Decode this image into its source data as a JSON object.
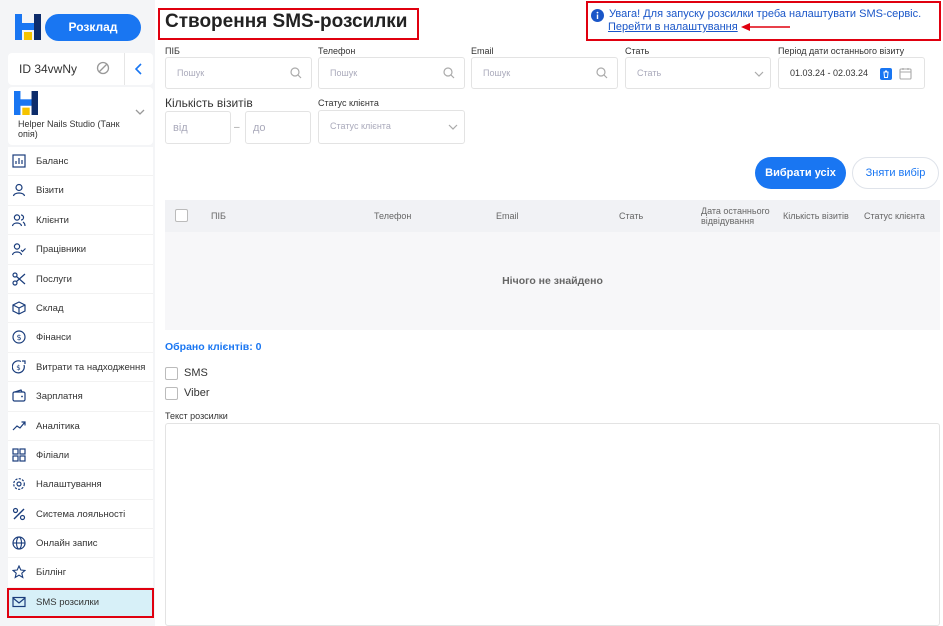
{
  "sidebar": {
    "schedule_label": "Розклад",
    "id_label": "ID 34vwNy",
    "studio_name": "Helper Nails Studio (Танк опія)",
    "items": [
      {
        "label": "Баланс",
        "icon": "bar-chart-icon"
      },
      {
        "label": "Візити",
        "icon": "user-icon"
      },
      {
        "label": "Клієнти",
        "icon": "users-icon"
      },
      {
        "label": "Працівники",
        "icon": "user-check-icon"
      },
      {
        "label": "Послуги",
        "icon": "scissors-icon"
      },
      {
        "label": "Склад",
        "icon": "box-icon"
      },
      {
        "label": "Фінанси",
        "icon": "dollar-icon"
      },
      {
        "label": "Витрати та надходження",
        "icon": "dollar-arrow-icon"
      },
      {
        "label": "Зарплатня",
        "icon": "wallet-icon"
      },
      {
        "label": "Аналітика",
        "icon": "trend-icon"
      },
      {
        "label": "Філіали",
        "icon": "grid-icon"
      },
      {
        "label": "Налаштування",
        "icon": "gear-icon"
      },
      {
        "label": "Система лояльності",
        "icon": "percent-icon"
      },
      {
        "label": "Онлайн запис",
        "icon": "globe-icon"
      },
      {
        "label": "Біллінг",
        "icon": "star-icon"
      },
      {
        "label": "SMS розсилки",
        "icon": "mail-icon",
        "active": true
      }
    ]
  },
  "header": {
    "title": "Створення SMS-розсилки",
    "warning_text": "Увага! Для запуску розсилки треба налаштувати SMS-сервіс.",
    "warning_link": "Перейти в налаштування"
  },
  "filters": {
    "name_label": "ПІБ",
    "name_placeholder": "Пошук",
    "phone_label": "Телефон",
    "phone_placeholder": "Пошук",
    "email_label": "Email",
    "email_placeholder": "Пошук",
    "gender_label": "Стать",
    "gender_placeholder": "Стать",
    "period_label": "Період дати останнього візиту",
    "period_value": "01.03.24 - 02.03.24",
    "visits_label": "Кількість візитів",
    "visits_from": "від",
    "visits_to": "до",
    "status_label": "Статус клієнта",
    "status_placeholder": "Статус клієнта"
  },
  "actions": {
    "select_all": "Вибрати усіх",
    "clear_selection": "Зняти вибір"
  },
  "table": {
    "columns": [
      "ПІБ",
      "Телефон",
      "Email",
      "Стать",
      "Дата останнього відвідування",
      "Кількість візитів",
      "Статус клієнта"
    ],
    "empty_text": "Нічого не знайдено"
  },
  "selected_text": "Обрано клієнтів: 0",
  "channels": {
    "sms": "SMS",
    "viber": "Viber"
  },
  "message_label": "Текст розсилки",
  "colors": {
    "accent": "#1976f2",
    "highlight": "#e0000f",
    "active_bg": "#d7f0f8"
  }
}
